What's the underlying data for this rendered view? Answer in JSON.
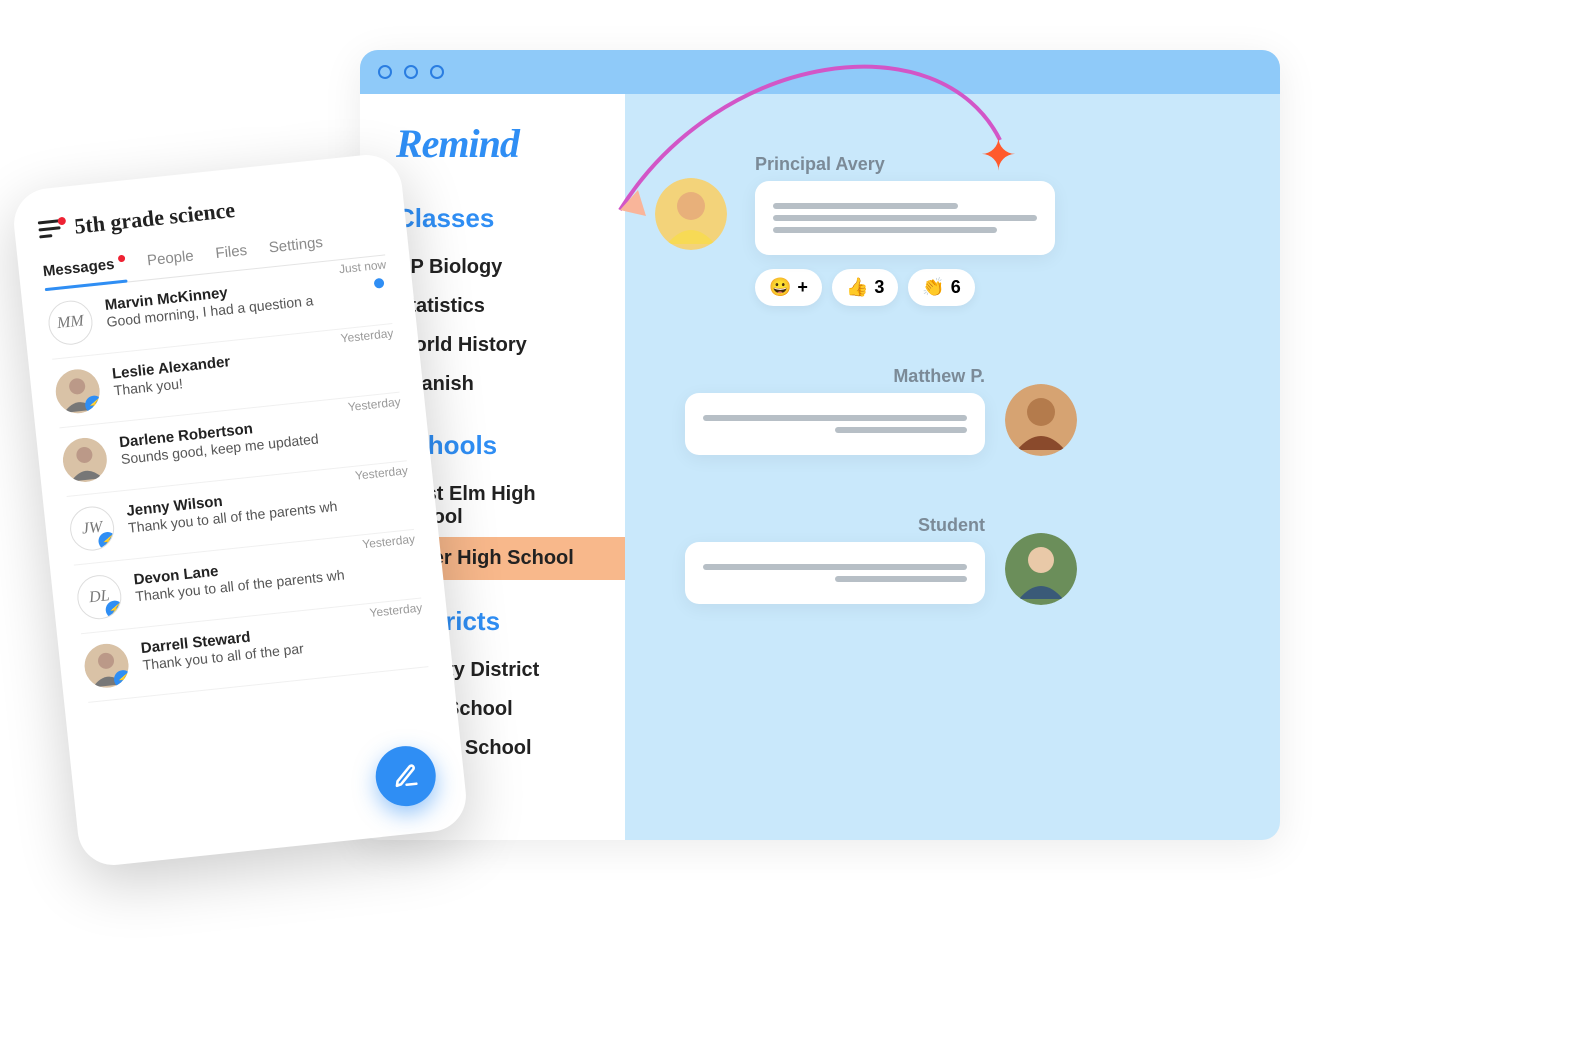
{
  "desktop": {
    "brand": "Remind",
    "sections": {
      "classes_title": "Classes",
      "classes": [
        "AP Biology",
        "Statistics",
        "World History",
        "Spanish"
      ],
      "schools_title": "Schools",
      "schools": [
        "West Elm High School",
        "Baker High School"
      ],
      "schools_selected_index": 1,
      "districts_title": "Districts",
      "districts": [
        "County District",
        "High School",
        "Middle School"
      ]
    },
    "chat": {
      "msg1_sender": "Principal Avery",
      "reactions": [
        {
          "emoji": "😀",
          "label": "+"
        },
        {
          "emoji": "👍",
          "count": "3"
        },
        {
          "emoji": "👏",
          "count": "6"
        }
      ],
      "msg2_sender": "Matthew P.",
      "msg3_sender": "Student"
    }
  },
  "phone": {
    "class_title": "5th grade science",
    "tabs": [
      "Messages",
      "People",
      "Files",
      "Settings"
    ],
    "active_tab_index": 0,
    "messages": [
      {
        "initials": "MM",
        "name": "Marvin McKinney",
        "preview": "Good morning, I had a question a",
        "when": "Just now",
        "unread": true,
        "photo": false,
        "bolt": false
      },
      {
        "initials": "",
        "name": "Leslie Alexander",
        "preview": "Thank you!",
        "when": "Yesterday",
        "unread": false,
        "photo": true,
        "bolt": true
      },
      {
        "initials": "",
        "name": "Darlene Robertson",
        "preview": "Sounds good, keep me updated",
        "when": "Yesterday",
        "unread": false,
        "photo": true,
        "bolt": false
      },
      {
        "initials": "JW",
        "name": "Jenny Wilson",
        "preview": "Thank you to all of the parents wh",
        "when": "Yesterday",
        "unread": false,
        "photo": false,
        "bolt": true
      },
      {
        "initials": "DL",
        "name": "Devon Lane",
        "preview": "Thank you to all of the parents wh",
        "when": "Yesterday",
        "unread": false,
        "photo": false,
        "bolt": true
      },
      {
        "initials": "",
        "name": "Darrell Steward",
        "preview": "Thank you to all of the par",
        "when": "Yesterday",
        "unread": false,
        "photo": true,
        "bolt": true
      }
    ],
    "fab_label": "compose"
  }
}
